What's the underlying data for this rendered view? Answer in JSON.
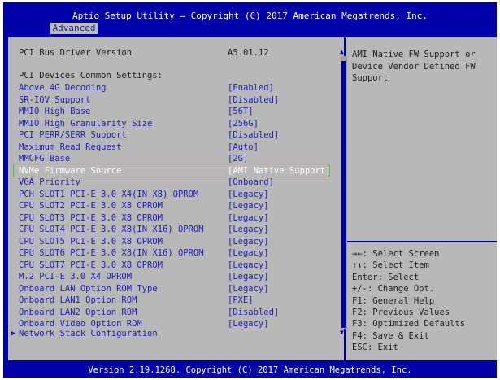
{
  "header": {
    "title": "Aptio Setup Utility – Copyright (C) 2017 American Megatrends, Inc.",
    "tab": "Advanced"
  },
  "main": {
    "driver_version": {
      "label": "PCI Bus Driver Version",
      "value": "A5.01.12"
    },
    "section_heading": "PCI Devices Common Settings:",
    "settings": [
      {
        "label": "Above 4G Decoding",
        "value": "[Enabled]"
      },
      {
        "label": "SR-IOV Support",
        "value": "[Disabled]"
      },
      {
        "label": "MMIO High Base",
        "value": "[56T]"
      },
      {
        "label": "MMIO High Granularity Size",
        "value": "[256G]"
      },
      {
        "label": "PCI PERR/SERR Support",
        "value": "[Disabled]"
      },
      {
        "label": "Maximum Read Request",
        "value": "[Auto]"
      },
      {
        "label": "MMCFG Base",
        "value": "[2G]"
      },
      {
        "label": "NVMe Firmware Source",
        "value": "[AMI Native Support]"
      },
      {
        "label": "VGA Priority",
        "value": "[Onboard]"
      },
      {
        "label": "PCH SLOT1 PCI-E 3.0 X4(IN X8) OPROM",
        "value": "[Legacy]"
      },
      {
        "label": "CPU SLOT2 PCI-E 3.0 X8 OPROM",
        "value": "[Legacy]"
      },
      {
        "label": "CPU SLOT3 PCI-E 3.0 X8 OPROM",
        "value": "[Legacy]"
      },
      {
        "label": "CPU SLOT4 PCI-E 3.0 X8(IN X16) OPROM",
        "value": "[Legacy]"
      },
      {
        "label": "CPU SLOT5 PCI-E 3.0 X8 OPROM",
        "value": "[Legacy]"
      },
      {
        "label": "CPU SLOT6 PCI-E 3.0 X8(IN X16) OPROM",
        "value": "[Legacy]"
      },
      {
        "label": "CPU SLOT7 PCI-E 3.0 X8 OPROM",
        "value": "[Legacy]"
      },
      {
        "label": "M.2 PCI-E 3.0 X4 OPROM",
        "value": "[Legacy]"
      },
      {
        "label": "Onboard LAN Option ROM Type",
        "value": "[Legacy]"
      },
      {
        "label": "Onboard LAN1 Option ROM",
        "value": "[PXE]"
      },
      {
        "label": "Onboard LAN2 Option ROM",
        "value": "[Disabled]"
      },
      {
        "label": "Onboard Video Option ROM",
        "value": "[Legacy]"
      }
    ],
    "submenu": {
      "label": "Network Stack Configuration"
    },
    "selected_index": 7
  },
  "help": {
    "lines": [
      "AMI Native FW Support or",
      "Device Vendor Defined FW",
      "Support"
    ]
  },
  "keys": [
    "→←: Select Screen",
    "↑↓: Select Item",
    "Enter: Select",
    "+/-: Change Opt.",
    "F1: General Help",
    "F2: Previous Values",
    "F3: Optimized Defaults",
    "F4: Save & Exit",
    "ESC: Exit"
  ],
  "footer": "Version 2.19.1268. Copyright (C) 2017 American Megatrends, Inc.",
  "colors": {
    "background": "#0000a8",
    "panel": "#b8b8b8",
    "setting_text": "#2020b4",
    "static_text": "#202020",
    "selected_text": "#ffffff",
    "highlight_border": "#32d232"
  }
}
